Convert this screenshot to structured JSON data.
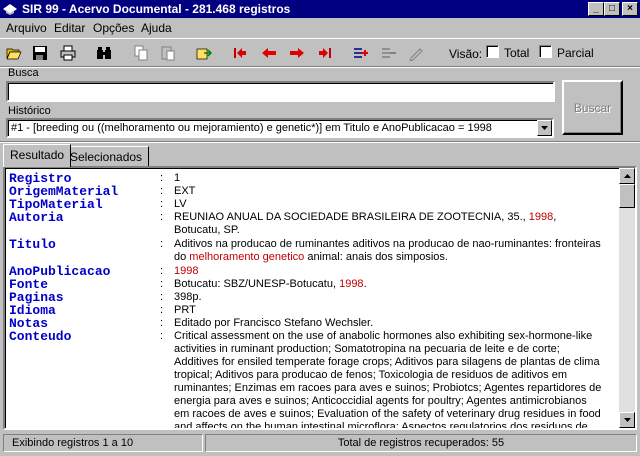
{
  "window": {
    "title": "SIR 99 - Acervo Documental - 281.468 registros",
    "controls": {
      "minimize": "_",
      "maximize": "□",
      "close": "×"
    }
  },
  "menu": [
    {
      "label": "Arquivo"
    },
    {
      "label": "Editar"
    },
    {
      "label": "Opções"
    },
    {
      "label": "Ajuda"
    }
  ],
  "toolbar": {
    "icons": [
      "open-folder-icon",
      "save-icon",
      "print-icon",
      "binoculars-icon",
      "copy-icon",
      "paste-icon",
      "export-icon",
      "first-record-icon",
      "previous-record-icon",
      "next-record-icon",
      "last-record-icon",
      "select-icon",
      "deselect-icon",
      "edit-icon"
    ],
    "visao_label": "Visão:",
    "visao_total": "Total",
    "visao_parcial": "Parcial"
  },
  "busca": {
    "label": "Busca",
    "value": "",
    "button": "Buscar"
  },
  "historico": {
    "label": "Histórico",
    "value": "#1 - [breeding ou ((melhoramento ou mejoramiento) e genetic*)] em Titulo e AnoPublicacao = 1998"
  },
  "tabs": [
    {
      "label": "Resultado",
      "active": true
    },
    {
      "label": "Selecionados",
      "active": false
    }
  ],
  "record": {
    "colon": ":",
    "registro": {
      "name": "Registro",
      "value": "1"
    },
    "origem": {
      "name": "OrigemMaterial",
      "value": "EXT"
    },
    "tipo": {
      "name": "TipoMaterial",
      "value": "LV"
    },
    "autoria": {
      "name": "Autoria",
      "before": "REUNIAO ANUAL DA SOCIEDADE BRASILEIRA DE ZOOTECNIA, 35., ",
      "highlight": "1998",
      "after": ", Botucatu, SP."
    },
    "titulo": {
      "name": "Titulo",
      "before": "Aditivos na producao de ruminantes aditivos na producao de nao-ruminantes: fronteiras do ",
      "highlight": "melhoramento genetico",
      "after": " animal: anais dos simposios."
    },
    "ano": {
      "name": "AnoPublicacao",
      "value": "1998"
    },
    "fonte": {
      "name": "Fonte",
      "before": "Botucatu: SBZ/UNESP-Botucatu, ",
      "highlight": "1998",
      "after": "."
    },
    "paginas": {
      "name": "Paginas",
      "value": "398p."
    },
    "idioma": {
      "name": "Idioma",
      "value": "PRT"
    },
    "notas": {
      "name": "Notas",
      "value": "Editado por Francisco Stefano Wechsler."
    },
    "conteudo": {
      "name": "Conteudo",
      "value": "Critical assessment on the use of anabolic hormones also exhibiting sex-hormone-like activities in ruminant production; Somatotropina na pecuaria de leite e de corte; Additives for ensiled temperate forage crops; Aditivos para silagens de plantas de clima tropical; Aditivos para producao de fenos; Toxicologia de residuos de aditivos em ruminantes; Enzimas em racoes para aves e suinos; Probiotcs; Agentes repartidores de energia para aves e suinos; Anticoccidial agents for poultry; Agentes antimicrobianos em racoes de aves e suinos; Evaluation of the safety of veterinary drug residues in food and affects on the human intestinal microflora; Aspectos regulatorios dos residuos de drogas de uso veterinario em"
    }
  },
  "status": {
    "left": "Exibindo registros 1 a 10",
    "right": "Total de registros recuperados: 55"
  },
  "colors": {
    "field": "#0000c8",
    "highlight": "#c00000",
    "titlebar": "#000080"
  }
}
